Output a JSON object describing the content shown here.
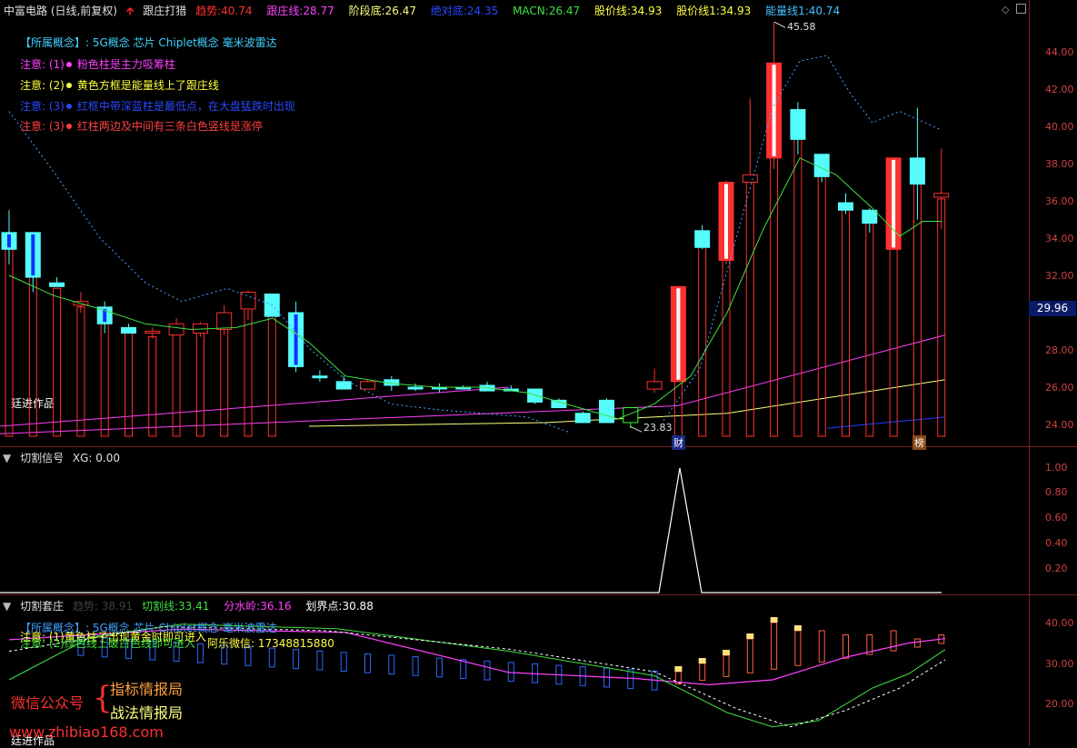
{
  "header": {
    "stock": "中富电路 (日线,前复权)",
    "indicator": "跟庄打猎",
    "trend_label": "趋势:",
    "trend_val": "40.74",
    "follow_label": "跟庄线:",
    "follow_val": "28.77",
    "stage_label": "阶段底:",
    "stage_val": "26.47",
    "abs_label": "绝对底:",
    "abs_val": "24.35",
    "macn_label": "MACN:",
    "macn_val": "26.47",
    "price_label": "股价线:",
    "price_val": "34.93",
    "price1_label": "股价线1:",
    "price1_val": "34.93",
    "energy_label": "能量线1:",
    "energy_val": "40.74"
  },
  "notes": {
    "concept": "【所属概念】:  5G概念 芯片 Chiplet概念 毫米波雷达",
    "n1": "注意: (1)",
    "n1_text": "粉色柱是主力吸筹柱",
    "n2": "注意: (2)",
    "n2_text": "黄色方框是能量线上了跟庄线",
    "n3": "注意: (3)",
    "n3_text": "红框中带深蓝柱是最低点，在大盘猛跌时出现",
    "n4": "注意: (3)",
    "n4_text": "红柱两边及中间有三条白色竖线是涨停",
    "author": "廷进作品"
  },
  "main_axis": {
    "ticks": [
      "44.00",
      "42.00",
      "40.00",
      "38.00",
      "36.00",
      "34.00",
      "32.00",
      "30.00",
      "28.00",
      "26.00",
      "24.00"
    ],
    "price_tag": "29.96",
    "high_label": "45.58",
    "low_label": "23.83",
    "badge_cai": "财",
    "badge_bang": "榜"
  },
  "panel2": {
    "title": "切割信号",
    "xg": "XG: 0.00",
    "ticks": [
      "1.00",
      "0.80",
      "0.60",
      "0.40",
      "0.20"
    ]
  },
  "panel3": {
    "title": "切割套庄",
    "faded": "趋势: 38.91",
    "cut_label": "切割线:",
    "cut_val": "33.41",
    "water_label": "分水岭:",
    "water_val": "36.16",
    "bound_label": "划界点:",
    "bound_val": "30.88",
    "ticks": [
      "40.00",
      "30.00",
      "20.00"
    ],
    "overlay1": "【所属概念】:  5G概念 芯片 Chiplet概念 毫米波雷达",
    "overlay2": "注意: (1)黄色柱子出现黄金时即可进入",
    "overlay3": "注意: (2)绿色线上破白色线即可进入",
    "wechat": "阿乐微信: 17348815880",
    "author": "廷进作品"
  },
  "watermark": {
    "left": "微信公众号",
    "brace": "{",
    "line1": "指标情报局",
    "line2": "战法情报局",
    "url": "www.zhibiao168.com"
  },
  "colors": {
    "up": "#ff3030",
    "down": "#54fcfc",
    "ma": "#40e040",
    "support": "#ff40ff",
    "dotted": "#4aa0ff",
    "long": "#ffff80",
    "blue": "#2040ff"
  },
  "chart_data": {
    "type": "candlestick",
    "ylim": [
      23.2,
      46.0
    ],
    "candles": [
      [
        34.3,
        35.5,
        33.4,
        32.6,
        "down"
      ],
      [
        34.3,
        34.3,
        31.9,
        31.1,
        "down"
      ],
      [
        31.6,
        31.9,
        31.4,
        31.4,
        "down"
      ],
      [
        30.6,
        31.1,
        30.4,
        30.0,
        "up"
      ],
      [
        30.3,
        30.6,
        29.4,
        28.9,
        "down"
      ],
      [
        29.2,
        29.4,
        28.9,
        28.9,
        "down"
      ],
      [
        29.0,
        29.2,
        29.0,
        28.6,
        "up"
      ],
      [
        28.8,
        29.7,
        29.4,
        28.8,
        "up"
      ],
      [
        28.9,
        29.5,
        29.4,
        28.7,
        "up"
      ],
      [
        29.1,
        30.4,
        30.0,
        28.8,
        "up"
      ],
      [
        30.2,
        31.2,
        31.1,
        29.6,
        "up"
      ],
      [
        31.0,
        31.0,
        29.8,
        29.8,
        "down"
      ],
      [
        30.0,
        30.6,
        27.1,
        26.8,
        "down"
      ],
      [
        26.6,
        26.9,
        26.6,
        26.3,
        "down"
      ],
      [
        26.3,
        26.6,
        25.9,
        25.9,
        "down"
      ],
      [
        25.9,
        26.4,
        26.3,
        25.9,
        "up"
      ],
      [
        26.4,
        26.6,
        26.1,
        25.8,
        "down"
      ],
      [
        26.0,
        26.2,
        25.9,
        25.8,
        "down"
      ],
      [
        26.0,
        26.2,
        26.0,
        25.7,
        "down"
      ],
      [
        26.0,
        26.1,
        26.0,
        25.9,
        "down"
      ],
      [
        26.1,
        26.3,
        25.8,
        25.8,
        "down"
      ],
      [
        25.9,
        26.1,
        25.8,
        25.8,
        "down"
      ],
      [
        25.9,
        25.9,
        25.2,
        25.1,
        "down"
      ],
      [
        25.3,
        25.4,
        24.9,
        24.9,
        "down"
      ],
      [
        24.6,
        24.7,
        24.1,
        24.1,
        "down"
      ],
      [
        25.3,
        25.4,
        24.1,
        24.1,
        "down"
      ],
      [
        24.9,
        24.9,
        24.1,
        23.8,
        "up_green"
      ],
      [
        25.9,
        27.0,
        26.3,
        25.7,
        "up"
      ],
      [
        26.3,
        31.4,
        31.4,
        26.3,
        "up"
      ],
      [
        34.4,
        34.7,
        33.5,
        33.4,
        "down"
      ],
      [
        32.8,
        37.1,
        37.0,
        32.6,
        "up"
      ],
      [
        37.0,
        41.5,
        37.4,
        37.4,
        "up"
      ],
      [
        38.3,
        45.6,
        43.4,
        37.7,
        "up"
      ],
      [
        40.9,
        41.3,
        39.3,
        38.5,
        "down"
      ],
      [
        38.5,
        38.5,
        37.3,
        37.0,
        "down"
      ],
      [
        35.9,
        36.4,
        35.5,
        35.3,
        "down"
      ],
      [
        35.5,
        35.6,
        34.8,
        34.3,
        "down"
      ],
      [
        33.4,
        38.3,
        38.3,
        33.4,
        "up"
      ],
      [
        38.3,
        41.0,
        36.9,
        35.0,
        "down"
      ],
      [
        36.2,
        38.8,
        36.4,
        34.5,
        "up"
      ]
    ]
  }
}
